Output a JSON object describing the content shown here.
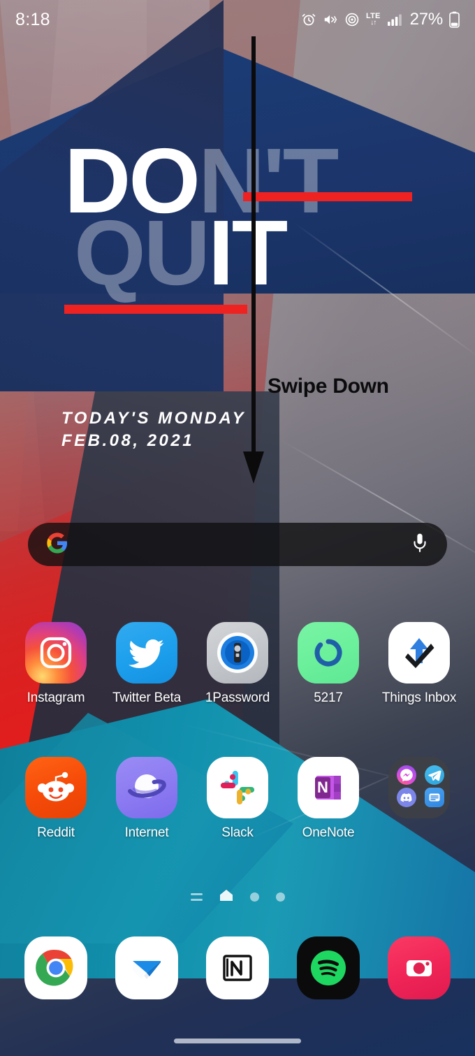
{
  "statusbar": {
    "time": "8:18",
    "battery_percent": "27%",
    "network_label": "LTE",
    "network_arrows": "↓↑",
    "icons": [
      "alarm-icon",
      "mute-vibrate-icon",
      "hotspot-icon",
      "lte-indicator",
      "signal-bars-icon",
      "battery-icon"
    ]
  },
  "wallpaper": {
    "headline_line1_strong": "DO",
    "headline_line1_faded": "N'T",
    "headline_line2_faded": "QU",
    "headline_line2_strong": "IT",
    "date_line1": "TODAY'S MONDAY",
    "date_line2": "FEB.08, 2021",
    "accent_red": "#ef2222"
  },
  "annotation": {
    "label": "Swipe Down",
    "arrow_color": "#0b0b0c"
  },
  "search": {
    "placeholder": "",
    "value": "",
    "left_icon": "google-g-icon",
    "right_icon": "microphone-icon"
  },
  "home_rows": [
    [
      {
        "label": "Instagram",
        "icon": "instagram-icon"
      },
      {
        "label": "Twitter Beta",
        "icon": "twitter-icon"
      },
      {
        "label": "1Password",
        "icon": "onepassword-icon"
      },
      {
        "label": "5217",
        "icon": "5217-timer-icon"
      },
      {
        "label": "Things Inbox",
        "icon": "things-inbox-icon"
      }
    ],
    [
      {
        "label": "Reddit",
        "icon": "reddit-icon"
      },
      {
        "label": "Internet",
        "icon": "samsung-internet-icon"
      },
      {
        "label": "Slack",
        "icon": "slack-icon"
      },
      {
        "label": "OneNote",
        "icon": "onenote-icon"
      },
      {
        "label": "",
        "icon": "messaging-folder-icon"
      }
    ]
  ],
  "folder": {
    "label": "",
    "apps": [
      "messenger-icon",
      "telegram-icon",
      "discord-icon",
      "samsung-messages-icon"
    ]
  },
  "page_indicator": {
    "items": [
      "feed-page",
      "home-page",
      "page-3",
      "page-4"
    ],
    "active_index": 1
  },
  "dock": [
    {
      "label": "",
      "icon": "chrome-icon"
    },
    {
      "label": "",
      "icon": "email-icon"
    },
    {
      "label": "",
      "icon": "notion-icon"
    },
    {
      "label": "",
      "icon": "spotify-icon"
    },
    {
      "label": "",
      "icon": "camera-icon"
    }
  ],
  "navigation": {
    "gesture_pill": "home-gesture-pill"
  }
}
